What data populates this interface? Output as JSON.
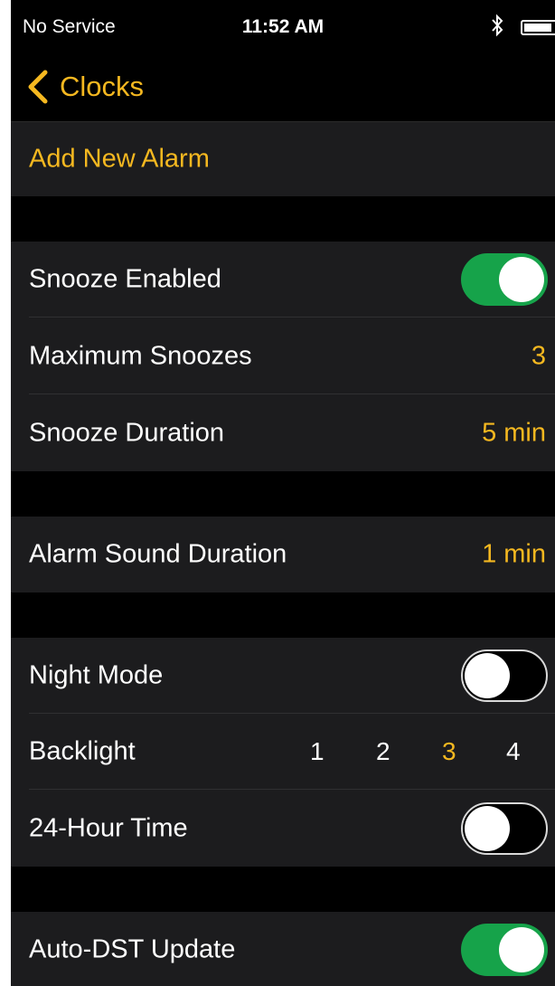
{
  "status_bar": {
    "carrier": "No Service",
    "time": "11:52 AM"
  },
  "nav": {
    "back_label": "Clocks"
  },
  "alarm": {
    "add_label": "Add New Alarm"
  },
  "snooze": {
    "enabled_label": "Snooze Enabled",
    "enabled": true,
    "max_label": "Maximum Snoozes",
    "max_value": "3",
    "duration_label": "Snooze Duration",
    "duration_value": "5 min"
  },
  "sound": {
    "label": "Alarm Sound Duration",
    "value": "1 min"
  },
  "display": {
    "night_mode_label": "Night Mode",
    "night_mode": false,
    "backlight_label": "Backlight",
    "backlight_options": [
      "1",
      "2",
      "3",
      "4"
    ],
    "backlight_selected": "3",
    "hour24_label": "24-Hour Time",
    "hour24": false
  },
  "dst": {
    "label": "Auto-DST Update",
    "enabled": true
  },
  "colors": {
    "accent": "#f5b820",
    "toggle_on": "#16a34a",
    "row_bg": "#1c1c1e",
    "background": "#000000"
  },
  "icons": {
    "back": "chevron-left-icon",
    "bluetooth": "bluetooth-icon",
    "battery": "battery-icon"
  }
}
